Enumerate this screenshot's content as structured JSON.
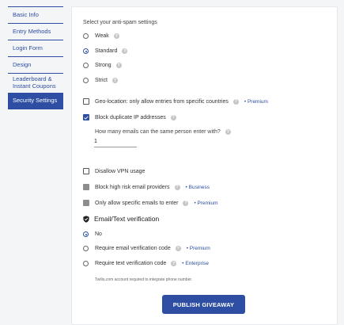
{
  "sidebar": {
    "items": [
      {
        "label": "Basic Info"
      },
      {
        "label": "Entry Methods"
      },
      {
        "label": "Login Form"
      },
      {
        "label": "Design"
      },
      {
        "label": "Leaderboard & Instant Coupons"
      },
      {
        "label": "Security Settings",
        "active": true
      }
    ]
  },
  "antispam": {
    "heading": "Select your anti-spam settings",
    "options": [
      {
        "label": "Weak",
        "selected": false
      },
      {
        "label": "Standard",
        "selected": true
      },
      {
        "label": "Strong",
        "selected": false
      },
      {
        "label": "Strict",
        "selected": false
      }
    ]
  },
  "geo": {
    "label": "Geo-location: only allow entries from specific countries",
    "tier": "• Premium",
    "checked": false
  },
  "dup_ip": {
    "label": "Block duplicate IP addresses",
    "checked": true
  },
  "emails_question": {
    "label": "How many emails can the same person enter with?",
    "value": "1"
  },
  "vpn": {
    "label": "Disallow VPN usage",
    "checked": false
  },
  "high_risk": {
    "label": "Block high risk email providers",
    "tier": "• Business"
  },
  "specific_emails": {
    "label": "Only allow specific emails to enter",
    "tier": "• Premium"
  },
  "verification": {
    "title": "Email/Text verification",
    "options": [
      {
        "label": "No",
        "selected": true
      },
      {
        "label": "Require email verification code",
        "tier": "• Premium"
      },
      {
        "label": "Require text verification code",
        "tier": "• Enterprise"
      }
    ],
    "note": "Twilio.com account required to integrate phone number."
  },
  "publish_label": "PUBLISH GIVEAWAY",
  "colors": {
    "accent": "#2d4ea2",
    "disabled": "#8d8d8d"
  }
}
